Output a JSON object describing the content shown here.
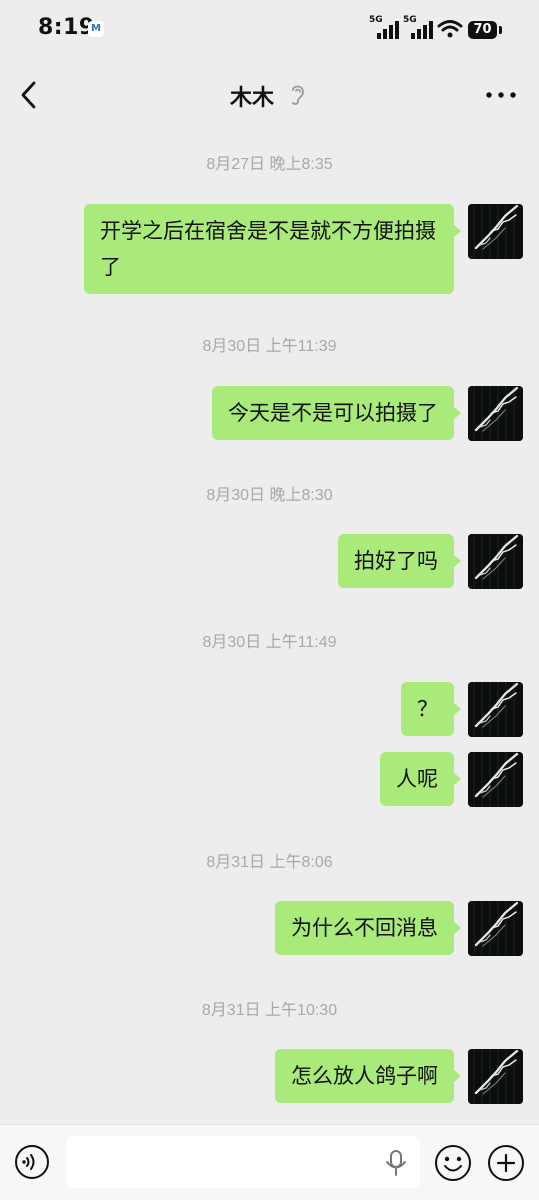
{
  "status_bar": {
    "time": "8:19",
    "notification_icon": "gmail-icon",
    "network_1": "5G",
    "network_2": "5G",
    "battery": "70"
  },
  "header": {
    "title": "木木",
    "back_icon": "chevron-left-icon",
    "ear_icon": "ear-icon",
    "more_icon": "more-icon"
  },
  "messages": [
    {
      "timestamp": "8月27日 晚上8:35",
      "bubbles": [
        "开学之后在宿舍是不是就不方便拍摄了"
      ]
    },
    {
      "timestamp": "8月30日 上午11:39",
      "bubbles": [
        "今天是不是可以拍摄了"
      ]
    },
    {
      "timestamp": "8月30日 晚上8:30",
      "bubbles": [
        "拍好了吗"
      ]
    },
    {
      "timestamp": "8月30日 上午11:49",
      "bubbles": [
        "？",
        "人呢"
      ]
    },
    {
      "timestamp": "8月31日 上午8:06",
      "bubbles": [
        "为什么不回消息"
      ]
    },
    {
      "timestamp": "8月31日 上午10:30",
      "bubbles": [
        "怎么放人鸽子啊"
      ]
    }
  ],
  "input_bar": {
    "voice_icon": "voice-icon",
    "message_placeholder": "",
    "mic_icon": "microphone-icon",
    "emoji_icon": "emoji-icon",
    "add_icon": "plus-icon"
  },
  "colors": {
    "background": "#ededed",
    "bubble": "#a9ea7a",
    "timestamp": "#a8a8a8",
    "input_bar": "#f7f7f7"
  }
}
